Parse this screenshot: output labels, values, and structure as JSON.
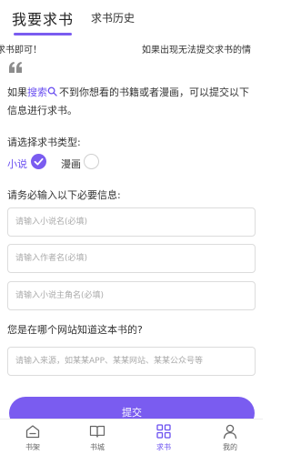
{
  "header": {
    "tabs": [
      {
        "label": "我要求书",
        "active": true
      },
      {
        "label": "求书历史",
        "active": false
      }
    ]
  },
  "notice": {
    "text_left": "求书即可！",
    "text_right": "如果出现无法提交求书的情"
  },
  "intro": {
    "before": "如果",
    "link": "搜索",
    "after": "不到你想看的书籍或者漫画，可以提交以下信息进行求书。"
  },
  "type_section": {
    "label": "请选择求书类型:",
    "options": [
      {
        "label": "小说",
        "checked": true
      },
      {
        "label": "漫画",
        "checked": false
      }
    ]
  },
  "required_section": {
    "label": "请务必输入以下必要信息:",
    "fields": [
      {
        "placeholder": "请输入小说名(必填)",
        "value": ""
      },
      {
        "placeholder": "请输入作者名(必填)",
        "value": ""
      },
      {
        "placeholder": "请输入小说主角名(必填)",
        "value": ""
      }
    ]
  },
  "source_section": {
    "label": "您是在哪个网站知道这本书的?",
    "placeholder": "请输入来源，如某某APP、某某网站、某某公众号等",
    "value": ""
  },
  "submit_label": "提交",
  "bottom_nav": {
    "items": [
      {
        "label": "书架",
        "icon": "bookshelf-icon",
        "active": false
      },
      {
        "label": "书城",
        "icon": "book-open-icon",
        "active": false
      },
      {
        "label": "求书",
        "icon": "grid-apps-icon",
        "active": true
      },
      {
        "label": "我的",
        "icon": "user-icon",
        "active": false
      }
    ]
  },
  "colors": {
    "accent": "#7a5cf0",
    "link": "#6a4ff0",
    "text": "#333333",
    "muted": "#aaaaaa"
  }
}
